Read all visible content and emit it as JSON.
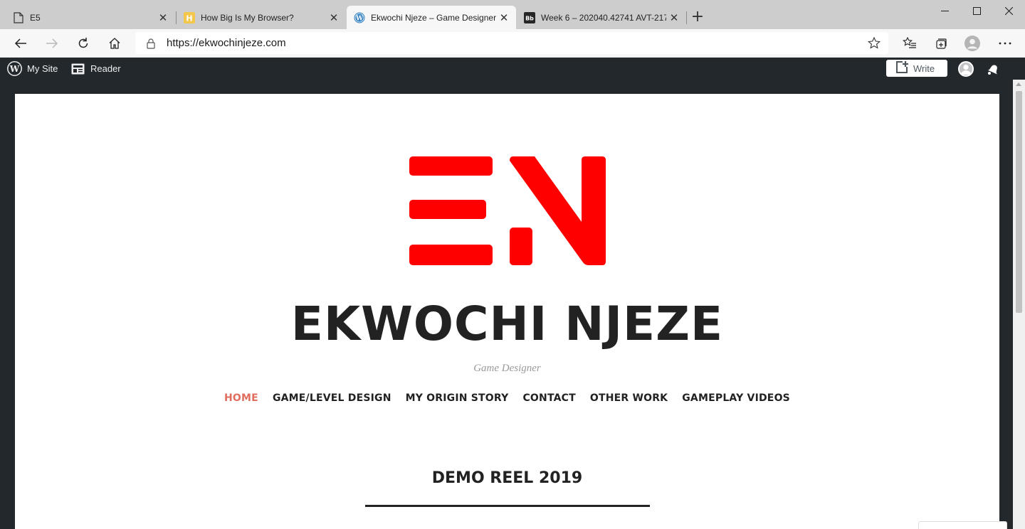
{
  "browser": {
    "tabs": [
      {
        "title": "E5",
        "icon": "page-icon"
      },
      {
        "title": "How Big Is My Browser?",
        "icon": "h-favicon"
      },
      {
        "title": "Ekwochi Njeze – Game Designer",
        "icon": "wordpress-icon",
        "active": true
      },
      {
        "title": "Week 6 – 202040.42741 AVT-217",
        "icon": "blackboard-icon"
      }
    ],
    "url": "https://ekwochinjeze.com"
  },
  "adminbar": {
    "my_site": "My Site",
    "reader": "Reader",
    "write": "Write"
  },
  "site": {
    "title": "EKWOCHI NJEZE",
    "tagline": "Game Designer",
    "logo_text": "EN",
    "logo_color": "#ff0000",
    "nav": [
      {
        "label": "HOME",
        "current": true
      },
      {
        "label": "GAME/LEVEL DESIGN"
      },
      {
        "label": "MY ORIGIN STORY"
      },
      {
        "label": "CONTACT"
      },
      {
        "label": "OTHER WORK"
      },
      {
        "label": "GAMEPLAY VIDEOS"
      }
    ],
    "section_heading": "DEMO REEL 2019",
    "accent_color": "#e06d5e"
  }
}
